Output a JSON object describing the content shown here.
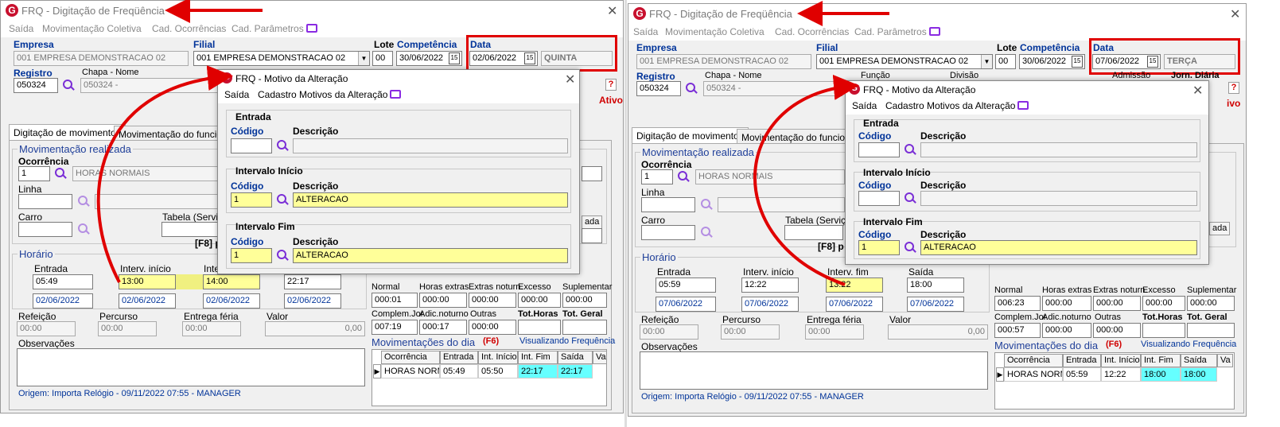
{
  "app": {
    "title": "FRQ - Digitação de Freqüência",
    "menu": [
      "Saída",
      "Movimentação Coletiva",
      "Cad. Ocorrências",
      "Cad. Parâmetros"
    ],
    "close": "✕"
  },
  "labels": {
    "empresa": "Empresa",
    "filial": "Filial",
    "lote": "Lote",
    "competencia": "Competência",
    "data": "Data",
    "registro": "Registro",
    "chapa_nome": "Chapa - Nome",
    "funcao": "Função",
    "divisao": "Divisão",
    "admissao": "Admissão",
    "jorn_diaria": "Jorn. Diária",
    "ativo": "Ativo",
    "tab_digitacao": "Digitação de movimentos",
    "tab_movimentacao": "Movimentação do funcionár",
    "mov_realizada": "Movimentação realizada",
    "ocorrencia": "Ocorrência",
    "linha": "Linha",
    "carro": "Carro",
    "tabela_servico": "Tabela (Serviço)",
    "f8": "[F8] p",
    "horario": "Horário",
    "entrada": "Entrada",
    "interv_inicio": "Interv. início",
    "interv_fim": "Interv. fim",
    "saida": "Saída",
    "refeicao": "Refeição",
    "percurso": "Percurso",
    "entrega_feria": "Entrega féria",
    "valor": "Valor",
    "observacoes": "Observações",
    "normal": "Normal",
    "horas_extras": "Horas extras",
    "extras_noturn": "Extras noturn.",
    "excesso": "Excesso",
    "suplementar": "Suplementar",
    "complem_jor": "Complem.Jor.",
    "adic_noturno": "Adic.noturno",
    "outras": "Outras",
    "tot_horas": "Tot.Horas",
    "tot_geral": "Tot. Geral",
    "mov_dia": "Movimentações do dia",
    "f6": "(F6)",
    "visualizando": "Visualizando Frequência",
    "ada": "ada",
    "question": "?"
  },
  "grid_headers": [
    "Ocorrência",
    "Entrada",
    "Int. Início",
    "Int. Fim",
    "Saída",
    "Va"
  ],
  "dialog": {
    "title": "FRQ - Motivo da Alteração",
    "menu": [
      "Saída",
      "Cadastro Motivos da Alteração"
    ],
    "close": "✕",
    "entrada": "Entrada",
    "intervalo_inicio": "Intervalo Início",
    "intervalo_fim": "Intervalo Fim",
    "codigo": "Código",
    "descricao": "Descrição"
  },
  "left": {
    "empresa": "001 EMPRESA DEMONSTRACAO 02",
    "filial": "001 EMPRESA DEMONSTRACAO 02",
    "lote": "00",
    "competencia": "30/06/2022",
    "data": "02/06/2022",
    "weekday": "QUINTA",
    "registro": "050324",
    "chapa": "050324 -",
    "ocorrencia_code": "1",
    "ocorrencia_desc": "HORAS NORMAIS",
    "entrada": "05:49",
    "int_inicio": "13:00",
    "int_fim": "14:00",
    "saida": "22:17",
    "date_row": [
      "02/06/2022",
      "02/06/2022",
      "02/06/2022",
      "02/06/2022"
    ],
    "refeicao": "00:00",
    "percurso": "00:00",
    "entrega_feria": "00:00",
    "valor": "0,00",
    "totals_row1": [
      "000:01",
      "000:00",
      "000:00",
      "000:00",
      "000:00"
    ],
    "totals_row2": [
      "007:19",
      "000:17",
      "000:00",
      "",
      ""
    ],
    "grid_row": [
      "HORAS NORMA",
      "05:49",
      "05:50",
      "22:17",
      "22:17"
    ],
    "origem": "Origem: Importa Relógio - 09/11/2022 07:55 - MANAGER",
    "dlg_inicio_code": "1",
    "dlg_inicio_desc": "ALTERACAO",
    "dlg_fim_code": "1",
    "dlg_fim_desc": "ALTERACAO"
  },
  "right": {
    "empresa": "001 EMPRESA DEMONSTRACAO 02",
    "filial": "001 EMPRESA DEMONSTRACAO 02",
    "lote": "00",
    "competencia": "30/06/2022",
    "data": "07/06/2022",
    "weekday": "TERÇA",
    "registro": "050324",
    "chapa": "050324 -",
    "ocorrencia_code": "1",
    "ocorrencia_desc": "HORAS NORMAIS",
    "entrada": "05:59",
    "int_inicio": "12:22",
    "int_fim": "13:22",
    "saida": "18:00",
    "date_row": [
      "07/06/2022",
      "07/06/2022",
      "07/06/2022",
      "07/06/2022"
    ],
    "refeicao": "00:00",
    "percurso": "00:00",
    "entrega_feria": "00:00",
    "valor": "0,00",
    "totals_row1": [
      "006:23",
      "000:00",
      "000:00",
      "000:00",
      "000:00"
    ],
    "totals_row2": [
      "000:57",
      "000:00",
      "000:00",
      "",
      ""
    ],
    "grid_row": [
      "HORAS NORM",
      "05:59",
      "12:22",
      "18:00",
      "18:00"
    ],
    "origem": "Origem: Importa Relógio - 09/11/2022 07:55 - MANAGER",
    "dlg_fim_code": "1",
    "dlg_fim_desc": "ALTERACAO"
  },
  "colors": {
    "annotation_red": "#e00000",
    "highlight_yellow": "#ffff99",
    "highlight_cyan": "#66ffff",
    "label_blue": "#003399"
  }
}
